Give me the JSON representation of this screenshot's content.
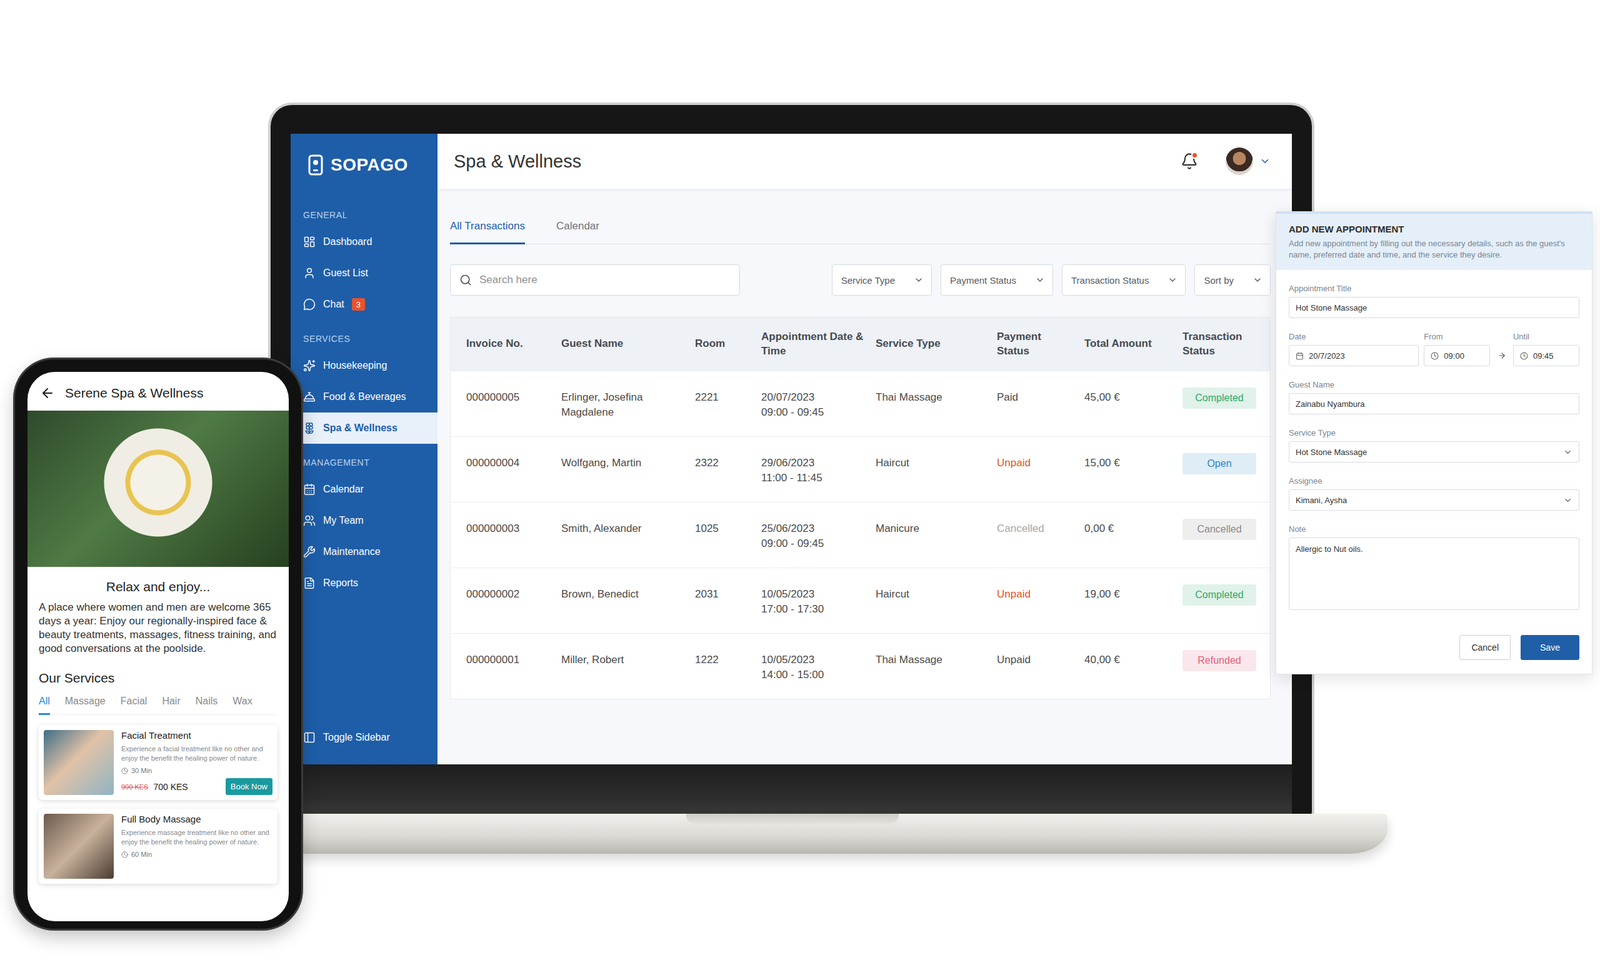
{
  "laptop": {
    "logo": "SOPAGO",
    "sidebar": {
      "sections": [
        {
          "title": "GENERAL",
          "items": [
            {
              "label": "Dashboard",
              "selected": false
            },
            {
              "label": "Guest List",
              "selected": false
            },
            {
              "label": "Chat",
              "badge": "3",
              "selected": false
            }
          ]
        },
        {
          "title": "SERVICES",
          "items": [
            {
              "label": "Housekeeping",
              "selected": false
            },
            {
              "label": "Food & Beverages",
              "selected": false
            },
            {
              "label": "Spa & Wellness",
              "selected": true
            }
          ]
        },
        {
          "title": "MANAGEMENT",
          "items": [
            {
              "label": "Calendar",
              "selected": false
            },
            {
              "label": "My Team",
              "selected": false
            },
            {
              "label": "Maintenance",
              "selected": false
            },
            {
              "label": "Reports",
              "selected": false
            }
          ]
        }
      ],
      "footer": "Toggle Sidebar"
    },
    "header": {
      "title": "Spa & Wellness",
      "notification_dot": true
    },
    "tabs": [
      {
        "label": "All Transactions",
        "selected": true
      },
      {
        "label": "Calendar",
        "selected": false
      }
    ],
    "search": {
      "placeholder": "Search here"
    },
    "filters": [
      "Service Type",
      "Payment Status",
      "Transaction Status",
      "Sort by"
    ],
    "table": {
      "columns": [
        "Invoice No.",
        "Guest Name",
        "Room",
        "Appointment Date & Time",
        "Service Type",
        "Payment Status",
        "Total Amount",
        "Transaction Status"
      ],
      "rows": [
        {
          "invoice": "000000005",
          "guest": "Erlinger, Josefina Magdalene",
          "room": "2221",
          "date": "20/07/2023",
          "time": "09:00 - 09:45",
          "service": "Thai Massage",
          "payment": {
            "text": "Paid",
            "color": "#4a4a4a"
          },
          "total": "45,00 €",
          "status": {
            "text": "Completed",
            "color": "#2fa86b"
          }
        },
        {
          "invoice": "000000004",
          "guest": "Wolfgang, Martin",
          "room": "2322",
          "date": "29/06/2023",
          "time": "11:00 - 11:45",
          "service": "Haircut",
          "payment": {
            "text": "Unpaid",
            "color": "#e0531f"
          },
          "total": "15,00 €",
          "status": {
            "text": "Open",
            "color": "#2b84c9"
          }
        },
        {
          "invoice": "000000003",
          "guest": "Smith, Alexander",
          "room": "1025",
          "date": "25/06/2023",
          "time": "09:00 - 09:45",
          "service": "Manicure",
          "payment": {
            "text": "Cancelled",
            "color": "#a6a6a6"
          },
          "total": "0,00 €",
          "status": {
            "text": "Cancelled",
            "color": "#8a8a8a"
          }
        },
        {
          "invoice": "000000002",
          "guest": "Brown, Benedict",
          "room": "2031",
          "date": "10/05/2023",
          "time": "17:00 - 17:30",
          "service": "Haircut",
          "payment": {
            "text": "Unpaid",
            "color": "#e0531f"
          },
          "total": "19,00 €",
          "status": {
            "text": "Completed",
            "color": "#2fa86b"
          }
        },
        {
          "invoice": "000000001",
          "guest": "Miller, Robert",
          "room": "1222",
          "date": "10/05/2023",
          "time": "14:00 - 15:00",
          "service": "Thai Massage",
          "payment": {
            "text": "Unpaid",
            "color": "#4a4a4a"
          },
          "total": "40,00 €",
          "status": {
            "text": "Refunded",
            "color": "#e0607c"
          }
        }
      ]
    }
  },
  "appointment_form": {
    "title": "ADD NEW APPOINTMENT",
    "description": "Add new appointment by filling out the necessary details, such as the guest's name, preferred date and time, and the service they desire.",
    "fields": [
      {
        "kind": "text",
        "label": "Appointment Title",
        "value": "Hot Stone Massage"
      },
      {
        "kind": "datetime",
        "date_label": "Date",
        "date": "20/7/2023",
        "from_label": "From",
        "from": "09:00",
        "until_label": "Until",
        "until": "09:45"
      },
      {
        "kind": "text",
        "label": "Guest Name",
        "value": "Zainabu Nyambura"
      },
      {
        "kind": "select",
        "label": "Service Type",
        "value": "Hot Stone Massage"
      },
      {
        "kind": "select",
        "label": "Assignee",
        "value": "Kimani, Aysha"
      },
      {
        "kind": "textarea",
        "label": "Note",
        "value": "Allergic to Nut oils."
      }
    ],
    "buttons": [
      {
        "label": "Cancel",
        "kind": "secondary"
      },
      {
        "label": "Save",
        "kind": "primary"
      }
    ]
  },
  "phone": {
    "title": "Serene Spa & Wellness",
    "heading": "Relax and enjoy...",
    "intro": "A place where women and men are welcome 365 days a year: Enjoy our regionally-inspired face & beauty treatments, massages, fitness training, and good conversations at the poolside.",
    "services_title": "Our Services",
    "tabs": [
      {
        "label": "All",
        "selected": true
      },
      {
        "label": "Massage",
        "selected": false
      },
      {
        "label": "Facial",
        "selected": false
      },
      {
        "label": "Hair",
        "selected": false
      },
      {
        "label": "Nails",
        "selected": false
      },
      {
        "label": "Wax",
        "selected": false
      }
    ],
    "services": [
      {
        "name": "Facial Treatment",
        "description": "Experience a facial treatment like no other and enjoy the benefit the healing power of nature.",
        "duration": "30 Min",
        "old_price": "900 KES",
        "price": "700 KES",
        "button": "Book Now"
      },
      {
        "name": "Full Body Massage",
        "description": "Experience massage treatment like no other and enjoy the benefit the healing power of nature.",
        "duration": "60 Min"
      }
    ]
  }
}
